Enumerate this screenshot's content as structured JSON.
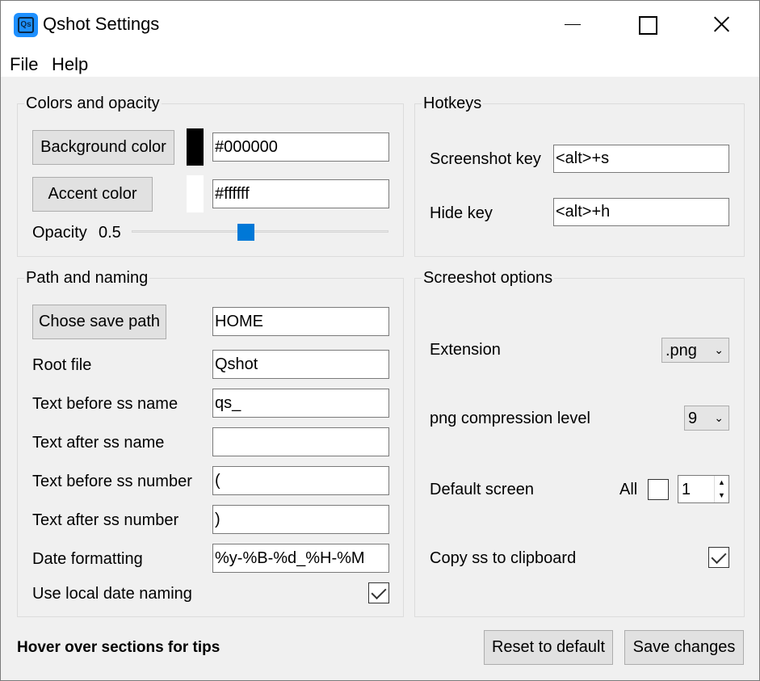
{
  "window": {
    "title": "Qshot Settings",
    "icon_text": "Qs",
    "icon_name": "qshot-app-icon"
  },
  "menu": [
    "File",
    "Help"
  ],
  "colors_group": {
    "title": "Colors and opacity",
    "background_button": "Background color",
    "background_value": "#000000",
    "background_swatch": "#000000",
    "accent_button": "Accent color",
    "accent_value": "#ffffff",
    "accent_swatch": "#ffffff",
    "opacity_label": "Opacity",
    "opacity_value": "0.5"
  },
  "hotkeys_group": {
    "title": "Hotkeys",
    "screenshot_label": "Screenshot key",
    "screenshot_value": "<alt>+s",
    "hide_label": "Hide key",
    "hide_value": "<alt>+h"
  },
  "path_group": {
    "title": "Path and naming",
    "save_path_button": "Chose save path",
    "save_path_value": "HOME",
    "root_file_label": "Root file",
    "root_file_value": "Qshot",
    "before_name_label": "Text before ss name",
    "before_name_value": "qs_",
    "after_name_label": "Text after ss name",
    "after_name_value": "",
    "before_number_label": "Text before ss number",
    "before_number_value": "(",
    "after_number_label": "Text after ss number",
    "after_number_value": ")",
    "date_format_label": "Date formatting",
    "date_format_value": "%y-%B-%d_%H-%M",
    "local_date_label": "Use local date naming",
    "local_date_checked": true
  },
  "screenshot_group": {
    "title": "Screeshot options",
    "extension_label": "Extension",
    "extension_value": ".png",
    "compression_label": "png compression level",
    "compression_value": "9",
    "default_screen_label": "Default screen",
    "all_label": "All",
    "all_checked": false,
    "screen_number": "1",
    "clipboard_label": "Copy ss to clipboard",
    "clipboard_checked": true
  },
  "footer": {
    "tip": "Hover over sections for tips",
    "reset_button": "Reset to default",
    "save_button": "Save changes"
  },
  "accent_color": "#0078d7"
}
